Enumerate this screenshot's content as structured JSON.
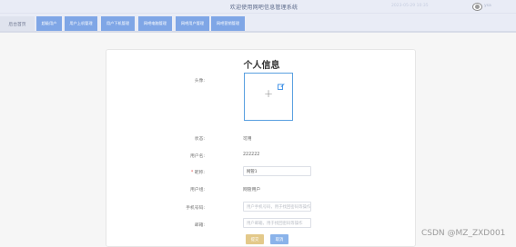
{
  "header": {
    "title": "欢迎使用网吧信息管理系统",
    "user_info": "2023-05-29 10:35",
    "user_name": "ysa"
  },
  "nav": {
    "home": "后台首页",
    "items": [
      {
        "label": "超级用户"
      },
      {
        "label": "用户上机管理"
      },
      {
        "label": "用户下机管理"
      },
      {
        "label": "网吧电脑管理"
      },
      {
        "label": "网吧用户管理"
      },
      {
        "label": "网吧营销管理"
      }
    ]
  },
  "profile": {
    "title": "个人信息",
    "avatar_label": "头像:",
    "status_label": "状态:",
    "status_value": "可用",
    "account_label": "用户名:",
    "account_value": "222222",
    "nickname_label": "昵称:",
    "nickname_value": "网管1",
    "group_label": "用户组:",
    "group_value": "网管用户",
    "phone_label": "手机号码:",
    "phone_placeholder": "用户手机号码，用于找回密码等操作",
    "email_label": "邮箱:",
    "email_placeholder": "用户邮箱，用于找回密码等操作",
    "submit_label": "提交",
    "cancel_label": "取消"
  },
  "watermark": "CSDN @MZ_ZXD001",
  "colors": {
    "nav_active": "#7fa6e6",
    "upload_border": "#5aa0e0",
    "submit": "#e3c98a",
    "cancel": "#8ab3ea"
  }
}
